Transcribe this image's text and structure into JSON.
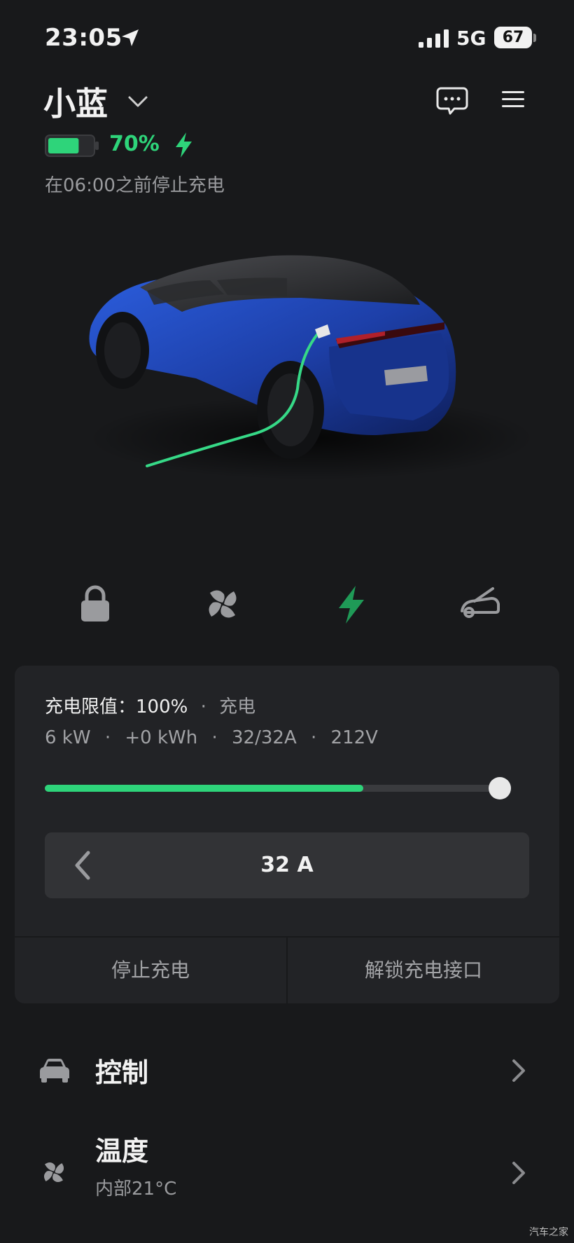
{
  "status_bar": {
    "time": "23:05",
    "network": "5G",
    "battery": "67"
  },
  "header": {
    "vehicle_name": "小蓝"
  },
  "battery": {
    "percent_label": "70%",
    "level": 0.7,
    "charge_note": "在06:00之前停止充电"
  },
  "charging": {
    "limit_label": "充电限值：",
    "limit_value": "100%",
    "separator": "·",
    "state": "充电",
    "power": "6 kW",
    "energy": "+0 kWh",
    "current": "32/32A",
    "voltage": "212V",
    "progress": 0.7,
    "amps": "32 A",
    "stop_button": "停止充电",
    "unlock_button": "解锁充电接口"
  },
  "menu": {
    "items": [
      {
        "title": "控制",
        "subtitle": ""
      },
      {
        "title": "温度",
        "subtitle": "内部21°C"
      }
    ]
  },
  "watermark": "汽车之家",
  "colors": {
    "accent": "#2ed47a",
    "background": "#18191b",
    "card": "#222326"
  }
}
